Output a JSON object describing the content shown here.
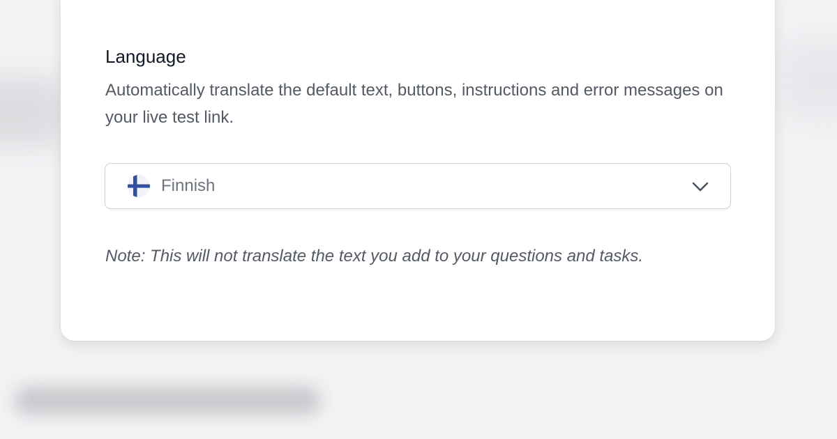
{
  "language_section": {
    "title": "Language",
    "description": "Automatically translate the default text, buttons, instructions and error messages on your live test link.",
    "select": {
      "selected_value": "Finnish",
      "flag_icon": "finland-flag-icon",
      "chevron_icon": "chevron-down-icon"
    },
    "note": "Note: This will not translate the text you add to your questions and tasks."
  },
  "colors": {
    "background": "#f2f3f5",
    "card": "#ffffff",
    "title": "#111827",
    "body_text": "#535a66",
    "flag_blue": "#2f4fa3"
  }
}
